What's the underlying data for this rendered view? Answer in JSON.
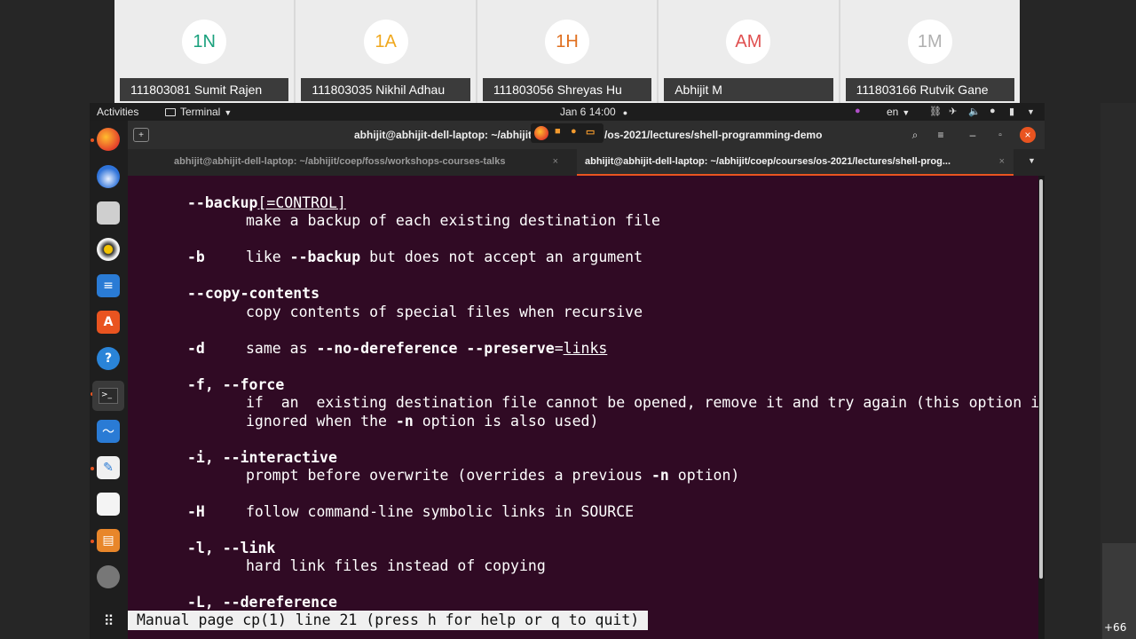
{
  "participants": [
    {
      "initials": "1N",
      "name": "111803081 Sumit Rajen",
      "color": "#1aa17d"
    },
    {
      "initials": "1A",
      "name": "111803035 Nikhil Adhau",
      "color": "#f0a81e"
    },
    {
      "initials": "1H",
      "name": "111803056 Shreyas Hu",
      "color": "#e07020"
    },
    {
      "initials": "AM",
      "name": "Abhijit M",
      "color": "#e05050"
    },
    {
      "initials": "1M",
      "name": "111803166 Rutvik Gane",
      "color": "#b0b0b0"
    }
  ],
  "more_participants": "+66",
  "topbar": {
    "activities": "Activities",
    "app_menu": "Terminal",
    "clock": "Jan 6  14:00",
    "language": "en"
  },
  "dock": {
    "items": [
      "firefox-icon",
      "thunderbird-icon",
      "files-icon",
      "rhythmbox-icon",
      "libreoffice-writer-icon",
      "software-center-icon",
      "help-icon",
      "terminal-icon",
      "system-monitor-icon",
      "text-editor-icon",
      "document-icon",
      "presentation-icon",
      "disc-icon",
      "show-apps-icon"
    ]
  },
  "window": {
    "title_left": "abhijit@abhijit-dell-laptop: ~/abhijit",
    "title_right": "/os-2021/lectures/shell-programming-demo"
  },
  "tabs": [
    {
      "label": "abhijit@abhijit-dell-laptop: ~/abhijit/coep/foss/workshops-courses-talks",
      "active": false
    },
    {
      "label": "abhijit@abhijit-dell-laptop: ~/abhijit/coep/courses/os-2021/lectures/shell-prog...",
      "active": true
    }
  ],
  "manpage": {
    "backup_opt": "--backup",
    "backup_arg": "[=CONTROL]",
    "backup_desc": "make a backup of each existing destination file",
    "b_opt": "-b",
    "b_desc_1": "like ",
    "b_desc_bold": "--backup",
    "b_desc_2": " but does not accept an argument",
    "copy_contents_opt": "--copy-contents",
    "copy_contents_desc": "copy contents of special files when recursive",
    "d_opt": "-d",
    "d_desc_1": "same as ",
    "d_desc_bold": "--no-dereference --preserve",
    "d_desc_2": "=",
    "d_desc_u": "links",
    "f_opt": "-f, --force",
    "f_desc_1": "if  an  existing destination file cannot be opened, remove it and try again (this option is",
    "f_desc_2a": "ignored when the ",
    "f_desc_2b": "-n",
    "f_desc_2c": " option is also used)",
    "i_opt": "-i, --interactive",
    "i_desc_1": "prompt before overwrite (overrides a previous ",
    "i_desc_bold": "-n",
    "i_desc_2": " option)",
    "H_opt": "-H",
    "H_desc": "follow command-line symbolic links in SOURCE",
    "l_opt": "-l, --link",
    "l_desc": "hard link files instead of copying",
    "L_opt": "-L, --dereference",
    "status": "Manual page cp(1) line 21 (press h for help or q to quit)"
  }
}
